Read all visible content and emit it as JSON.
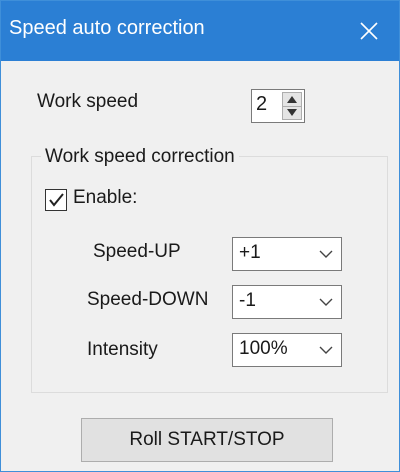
{
  "window": {
    "title": "Speed auto correction",
    "close_icon": "close-icon"
  },
  "work_speed": {
    "label": "Work speed",
    "value": "2"
  },
  "correction_group": {
    "label": "Work speed correction",
    "enable": {
      "label": "Enable:",
      "checked": true
    },
    "fields": [
      {
        "label": "Speed-UP",
        "value": "+1"
      },
      {
        "label": "Speed-DOWN",
        "value": "-1"
      },
      {
        "label": "Intensity",
        "value": "100%"
      }
    ]
  },
  "roll_button": {
    "label": "Roll START/STOP"
  },
  "colors": {
    "titlebar": "#2b7fd4",
    "window_bg": "#f0f0f0",
    "button_bg": "#e1e1e1"
  }
}
